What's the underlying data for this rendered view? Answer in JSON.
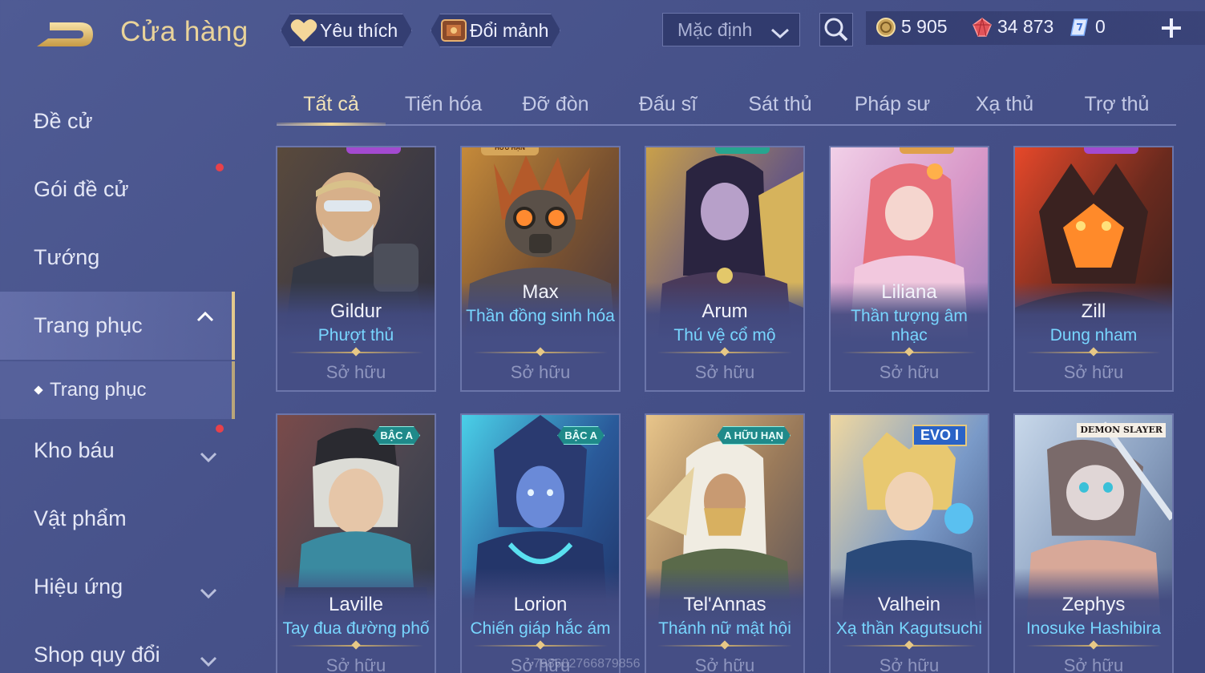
{
  "header": {
    "title": "Cửa hàng",
    "favorites_label": "Yêu thích",
    "shards_label": "Đổi mảnh",
    "sort_value": "Mặc định",
    "currencies": {
      "gold": "5 905",
      "ruby": "34 873",
      "voucher": "0"
    }
  },
  "sidebar": {
    "items": [
      {
        "label": "Đề cử"
      },
      {
        "label": "Gói đề cử"
      },
      {
        "label": "Tướng"
      },
      {
        "label": "Trang phục"
      },
      {
        "label": "Trang phục"
      },
      {
        "label": "Kho báu"
      },
      {
        "label": "Vật phẩm"
      },
      {
        "label": "Hiệu ứng"
      },
      {
        "label": "Shop quy đổi"
      }
    ]
  },
  "tabs": [
    "Tất cả",
    "Tiến hóa",
    "Đỡ đòn",
    "Đấu sĩ",
    "Sát thủ",
    "Pháp sư",
    "Xạ thủ",
    "Trợ thủ"
  ],
  "active_tab": "Tất cả",
  "cards": [
    {
      "hero": "Gildur",
      "skin": "Phượt thủ",
      "status": "Sở hữu",
      "badge": ""
    },
    {
      "hero": "Max",
      "skin": "Thần đồng sinh hóa",
      "status": "Sở hữu",
      "badge": "HỮU HẠN"
    },
    {
      "hero": "Arum",
      "skin": "Thú vệ cổ mộ",
      "status": "Sở hữu",
      "badge": ""
    },
    {
      "hero": "Liliana",
      "skin": "Thần tượng âm nhạc",
      "status": "Sở hữu",
      "badge": ""
    },
    {
      "hero": "Zill",
      "skin": "Dung nham",
      "status": "Sở hữu",
      "badge": ""
    },
    {
      "hero": "Laville",
      "skin": "Tay đua đường phố",
      "status": "Sở hữu",
      "badge": "BẬC A"
    },
    {
      "hero": "Lorion",
      "skin": "Chiến giáp hắc ám",
      "status": "Sở hữu",
      "badge": "BẬC A"
    },
    {
      "hero": "Tel'Annas",
      "skin": "Thánh nữ mật hội",
      "status": "Sở hữu",
      "badge": "A HỮU HẠN"
    },
    {
      "hero": "Valhein",
      "skin": "Xạ thần Kagutsuchi",
      "status": "Sở hữu",
      "badge": "EVO I"
    },
    {
      "hero": "Zephys",
      "skin": "Inosuke Hashibira",
      "status": "Sở hữu",
      "badge": "DEMON SLAYER"
    }
  ],
  "watermark": "798682766879856",
  "colors": {
    "background": "#4a558c",
    "title_gold": "#e9d39a",
    "skin_name_cyan": "#78d6ff",
    "notification_red": "#e8414a"
  }
}
